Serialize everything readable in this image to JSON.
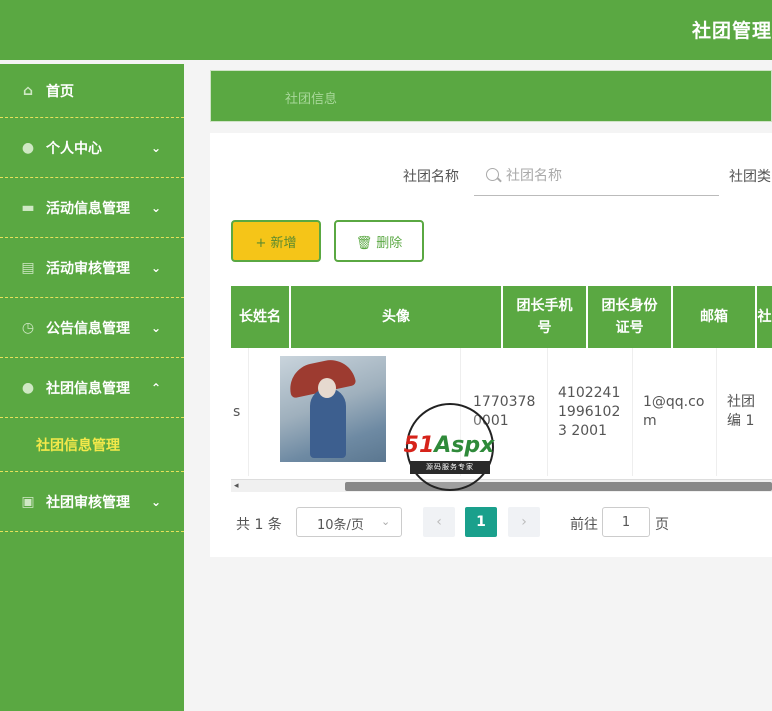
{
  "header": {
    "title": "社团管理"
  },
  "sidebar": {
    "items": [
      {
        "label": "首页",
        "icon": "home-icon",
        "glyph": "⌂"
      },
      {
        "label": "个人中心",
        "icon": "user-icon",
        "glyph": "●",
        "arrow": "⌄"
      },
      {
        "label": "活动信息管理",
        "icon": "briefcase-icon",
        "glyph": "▬",
        "arrow": "⌄"
      },
      {
        "label": "活动审核管理",
        "icon": "document-icon",
        "glyph": "▤",
        "arrow": "⌄"
      },
      {
        "label": "公告信息管理",
        "icon": "clock-icon",
        "glyph": "◷",
        "arrow": "⌄"
      },
      {
        "label": "社团信息管理",
        "icon": "user-icon",
        "glyph": "●",
        "arrow": "⌃"
      },
      {
        "label": "社团审核管理",
        "icon": "chart-icon",
        "glyph": "▣",
        "arrow": "⌄"
      }
    ],
    "submenu_label": "社团信息管理"
  },
  "breadcrumb": {
    "text": "社团信息"
  },
  "search": {
    "label": "社团名称",
    "placeholder": "社团名称",
    "label2": "社团类"
  },
  "toolbar": {
    "add_label": "新增",
    "add_icon": "+",
    "delete_label": "删除",
    "delete_icon": "🗑"
  },
  "table": {
    "headers": [
      "长姓名",
      "头像",
      "团长手机号",
      "团长身份证号",
      "邮箱",
      "社"
    ],
    "row": {
      "col0": "s",
      "phone": "17703780001",
      "id_number": "410224119961023 2001",
      "email": "1@qq.com",
      "extra": "社团编 1"
    },
    "scroll_left": "◂"
  },
  "pagination": {
    "total": "共 1 条",
    "page_size": "10条/页",
    "page_size_arrow": "⌄",
    "prev": "‹",
    "current": "1",
    "next": "›",
    "goto_label": "前往",
    "goto_value": "1",
    "goto_unit": "页"
  },
  "watermark": {
    "brand_red": "51",
    "brand_green": "Aspx",
    "tagline": "源码服务专家"
  }
}
